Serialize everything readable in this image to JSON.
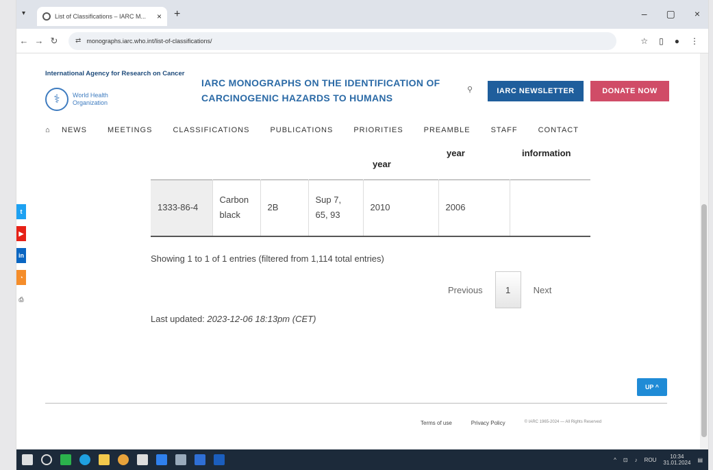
{
  "browser": {
    "tab_title": "List of Classifications – IARC M...",
    "url": "monographs.iarc.who.int/list-of-classifications/"
  },
  "site": {
    "agency": "International Agency for Research on Cancer",
    "who_line1": "World Health",
    "who_line2": "Organization",
    "title_line1": "IARC MONOGRAPHS ON THE IDENTIFICATION OF",
    "title_line2": "CARCINOGENIC HAZARDS TO HUMANS",
    "newsletter_label": "IARC NEWSLETTER",
    "donate_label": "DONATE NOW"
  },
  "nav": [
    "NEWS",
    "MEETINGS",
    "CLASSIFICATIONS",
    "PUBLICATIONS",
    "PRIORITIES",
    "PREAMBLE",
    "STAFF",
    "CONTACT"
  ],
  "table_header": {
    "year_pub": "year",
    "year_eval": "year",
    "info": "information"
  },
  "table_row": {
    "cas": "1333-86-4",
    "agent_line1": "Carbon",
    "agent_line2": "black",
    "group": "2B",
    "volume_line1": "Sup 7,",
    "volume_line2": "65, 93",
    "pub_year": "2010",
    "eval_year": "2006",
    "info": ""
  },
  "entries_info": "Showing 1 to 1 of 1 entries (filtered from 1,114 total entries)",
  "pager": {
    "previous": "Previous",
    "current": "1",
    "next": "Next"
  },
  "updated": {
    "label": "Last updated:",
    "value": "2023-12-06 18:13pm (CET)"
  },
  "up_label": "UP ^",
  "footer": {
    "terms": "Terms of use",
    "privacy": "Privacy Policy",
    "copyright": "© IARC 1965-2024 — All Rights Reserved"
  },
  "taskbar": {
    "time": "10:34",
    "date": "31.01.2024",
    "lang": "ROU"
  },
  "colors": {
    "newsletter": "#1f5e9c",
    "donate": "#d04c67",
    "title": "#2b6aa6"
  }
}
